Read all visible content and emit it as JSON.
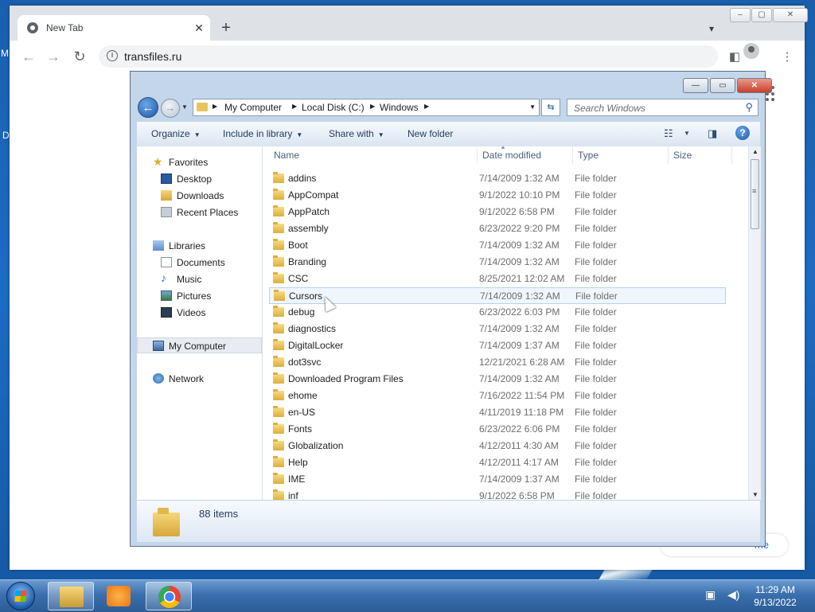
{
  "desktop": {
    "edge_letters": [
      "M",
      "D"
    ]
  },
  "chrome": {
    "tab_title": "New Tab",
    "tab_close": "✕",
    "new_tab": "+",
    "window_buttons": {
      "minimize": "–",
      "restore": "▢",
      "close": "✕"
    },
    "back": "←",
    "forward": "→",
    "reload": "↻",
    "url": "transfiles.ru",
    "customize_partial": "me"
  },
  "explorer": {
    "caption_buttons": {
      "minimize": "—",
      "maximize": "▭",
      "close": "✕"
    },
    "breadcrumbs": [
      "My Computer",
      "Local Disk (C:)",
      "Windows"
    ],
    "search_placeholder": "Search Windows",
    "commands": {
      "organize": "Organize",
      "include_in_library": "Include in library",
      "share_with": "Share with",
      "new_folder": "New folder"
    },
    "nav": {
      "favorites": "Favorites",
      "desktop": "Desktop",
      "downloads": "Downloads",
      "recent_places": "Recent Places",
      "libraries": "Libraries",
      "documents": "Documents",
      "music": "Music",
      "pictures": "Pictures",
      "videos": "Videos",
      "my_computer": "My Computer",
      "network": "Network"
    },
    "columns": {
      "name": "Name",
      "date_modified": "Date modified",
      "type": "Type",
      "size": "Size"
    },
    "files": [
      {
        "name": "addins",
        "date": "7/14/2009 1:32 AM",
        "type": "File folder"
      },
      {
        "name": "AppCompat",
        "date": "9/1/2022 10:10 PM",
        "type": "File folder"
      },
      {
        "name": "AppPatch",
        "date": "9/1/2022 6:58 PM",
        "type": "File folder"
      },
      {
        "name": "assembly",
        "date": "6/23/2022 9:20 PM",
        "type": "File folder"
      },
      {
        "name": "Boot",
        "date": "7/14/2009 1:32 AM",
        "type": "File folder"
      },
      {
        "name": "Branding",
        "date": "7/14/2009 1:32 AM",
        "type": "File folder"
      },
      {
        "name": "CSC",
        "date": "8/25/2021 12:02 AM",
        "type": "File folder"
      },
      {
        "name": "Cursors",
        "date": "7/14/2009 1:32 AM",
        "type": "File folder"
      },
      {
        "name": "debug",
        "date": "6/23/2022 6:03 PM",
        "type": "File folder"
      },
      {
        "name": "diagnostics",
        "date": "7/14/2009 1:32 AM",
        "type": "File folder"
      },
      {
        "name": "DigitalLocker",
        "date": "7/14/2009 1:37 AM",
        "type": "File folder"
      },
      {
        "name": "dot3svc",
        "date": "12/21/2021 6:28 AM",
        "type": "File folder"
      },
      {
        "name": "Downloaded Program Files",
        "date": "7/14/2009 1:32 AM",
        "type": "File folder"
      },
      {
        "name": "ehome",
        "date": "7/16/2022 11:54 PM",
        "type": "File folder"
      },
      {
        "name": "en-US",
        "date": "4/11/2019 11:18 PM",
        "type": "File folder"
      },
      {
        "name": "Fonts",
        "date": "6/23/2022 6:06 PM",
        "type": "File folder"
      },
      {
        "name": "Globalization",
        "date": "4/12/2011 4:30 AM",
        "type": "File folder"
      },
      {
        "name": "Help",
        "date": "4/12/2011 4:17 AM",
        "type": "File folder"
      },
      {
        "name": "IME",
        "date": "7/14/2009 1:37 AM",
        "type": "File folder"
      },
      {
        "name": "inf",
        "date": "9/1/2022 6:58 PM",
        "type": "File folder"
      }
    ],
    "hovered_index": 7,
    "item_count": "88 items"
  },
  "taskbar": {
    "time": "11:29 AM",
    "date": "9/13/2022"
  }
}
